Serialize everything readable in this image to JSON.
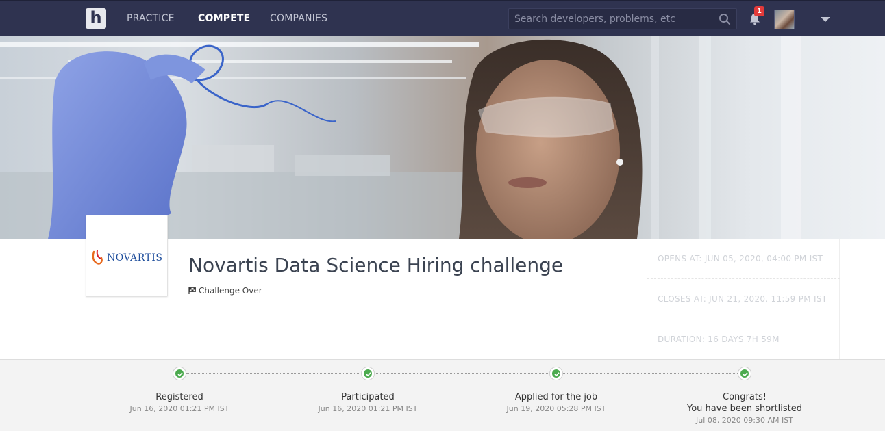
{
  "nav": {
    "links": [
      "PRACTICE",
      "COMPETE",
      "COMPANIES"
    ],
    "logo_letter": "h",
    "search_placeholder": "Search developers, problems, etc",
    "notification_count": "1"
  },
  "company": {
    "name": "NOVARTIS"
  },
  "challenge": {
    "title": "Novartis Data Science Hiring challenge",
    "status": "Challenge Over",
    "opens_at": "OPENS AT:  JUN 05, 2020, 04:00 PM IST",
    "closes_at": "CLOSES AT: JUN 21, 2020, 11:59 PM IST",
    "duration": "DURATION: 16 DAYS 7H 59M"
  },
  "timeline": {
    "steps": [
      {
        "label": "Registered",
        "sublabel": "",
        "date": "Jun 16, 2020 01:21 PM IST"
      },
      {
        "label": "Participated",
        "sublabel": "",
        "date": "Jun 16, 2020 01:21 PM IST"
      },
      {
        "label": "Applied for the job",
        "sublabel": "",
        "date": "Jun 19, 2020 05:28 PM IST"
      },
      {
        "label": "Congrats!",
        "sublabel": "You have been shortlisted",
        "date": "Jul 08, 2020 09:30 AM IST"
      }
    ]
  },
  "colors": {
    "navbar": "#2f3350",
    "success": "#4caa4f",
    "notification": "#e23a3a",
    "brand_blue": "#1f4e9c"
  }
}
